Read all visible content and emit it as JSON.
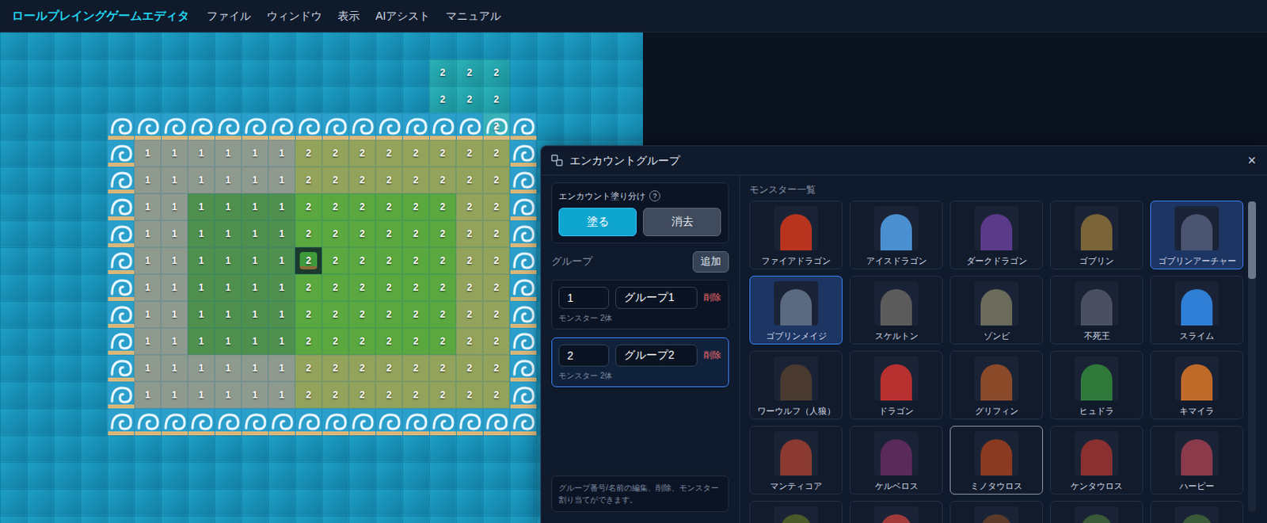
{
  "app": {
    "title": "ロールプレイングゲームエディタ",
    "menu": [
      "ファイル",
      "ウィンドウ",
      "表示",
      "AIアシスト",
      "マニュアル"
    ]
  },
  "map": {
    "rows": [
      {
        "terrain": "WWWWWWWWWWWWWWWWWWWWWWWW",
        "labels": "........................"
      },
      {
        "terrain": "WWWWWWWWWWWWWWWWwwwWWWWW",
        "labels": "................222....."
      },
      {
        "terrain": "WWWWWWWWWWWWWWWWwwwWWWWW",
        "labels": "................222....."
      },
      {
        "terrain": "WWWWSSSSSSSSSSSSSSsSWWWW",
        "labels": "..................2....."
      },
      {
        "terrain": "WWWWSAAAAAAEEEEEEEESWWWW",
        "labels": ".....11111122222222....."
      },
      {
        "terrain": "WWWWSAAAAAAEEEEEEEESWWWW",
        "labels": ".....11111122222222....."
      },
      {
        "terrain": "WWWWSAABBBBCCCCCCEESWWWW",
        "labels": ".....11111122222222....."
      },
      {
        "terrain": "WWWWSAABBBBCCCCCCEESWWWW",
        "labels": ".....11111122222222....."
      },
      {
        "terrain": "WWWWSAABBBBTCCCCCEESWWWW",
        "labels": ".....11111122222222....."
      },
      {
        "terrain": "WWWWSAABBBBCCCCCCEESWWWW",
        "labels": ".....11111122222222....."
      },
      {
        "terrain": "WWWWSAABBBBCCCCCCEESWWWW",
        "labels": ".....11111122222222....."
      },
      {
        "terrain": "WWWWSAABBBBCCCCCCEESWWWW",
        "labels": ".....11111122222222....."
      },
      {
        "terrain": "WWWWSAAAAAAEEEEEEEESWWWW",
        "labels": ".....11111122222222....."
      },
      {
        "terrain": "WWWWSAAAAAAEEEEEEEESWWWW",
        "labels": ".....11111122222222....."
      },
      {
        "terrain": "WWWWSSSSSSSSSSSSSSSSWWWW",
        "labels": "........................"
      },
      {
        "terrain": "WWWWWWWWWWWWWWWWWWWWWWWW",
        "labels": "........................"
      },
      {
        "terrain": "WWWWWWWWWWWWWWWWWWWWWWWW",
        "labels": "........................"
      },
      {
        "terrain": "WWWWWWWWWWWWWWWWWWWWWWWW",
        "labels": "........................"
      },
      {
        "terrain": "WWWWWWWWWWWWWWWWWWWWWWWW",
        "labels": "........................"
      }
    ]
  },
  "dialog": {
    "title": "エンカウントグループ",
    "close": "×",
    "paint": {
      "label": "エンカウント塗り分け",
      "help": "?",
      "modes": [
        {
          "label": "塗る",
          "selected": true
        },
        {
          "label": "消去",
          "selected": false
        }
      ]
    },
    "groups_label": "グループ",
    "add": "追加",
    "groups": [
      {
        "number": "1",
        "name": "グループ1",
        "delete": "削除",
        "count": "モンスター 2体",
        "selected": false
      },
      {
        "number": "2",
        "name": "グループ2",
        "delete": "削除",
        "count": "モンスター 2体",
        "selected": true
      }
    ],
    "hint": "グループ番号/名前の編集、削除、モンスター割り当てができます。",
    "monsters_label": "モンスター一覧",
    "monsters": [
      {
        "name": "ファイアドラゴン",
        "selected": false,
        "hovered": false,
        "color": "#b8341f"
      },
      {
        "name": "アイスドラゴン",
        "selected": false,
        "hovered": false,
        "color": "#4a8fd0"
      },
      {
        "name": "ダークドラゴン",
        "selected": false,
        "hovered": false,
        "color": "#5b3a8a"
      },
      {
        "name": "ゴブリン",
        "selected": false,
        "hovered": false,
        "color": "#7a6438"
      },
      {
        "name": "ゴブリンアーチャー",
        "selected": true,
        "hovered": false,
        "color": "#4a5470"
      },
      {
        "name": "ゴブリンメイジ",
        "selected": true,
        "hovered": false,
        "color": "#5a6a80"
      },
      {
        "name": "スケルトン",
        "selected": false,
        "hovered": false,
        "color": "#5b5b5b"
      },
      {
        "name": "ゾンビ",
        "selected": false,
        "hovered": false,
        "color": "#6b6b5b"
      },
      {
        "name": "不死王",
        "selected": false,
        "hovered": false,
        "color": "#4b5060"
      },
      {
        "name": "スライム",
        "selected": false,
        "hovered": false,
        "color": "#2f7fd6"
      },
      {
        "name": "ワーウルフ（人狼）",
        "selected": false,
        "hovered": false,
        "color": "#4a3a30"
      },
      {
        "name": "ドラゴン",
        "selected": false,
        "hovered": false,
        "color": "#b83030"
      },
      {
        "name": "グリフィン",
        "selected": false,
        "hovered": false,
        "color": "#8a4a2a"
      },
      {
        "name": "ヒュドラ",
        "selected": false,
        "hovered": false,
        "color": "#2f7a3a"
      },
      {
        "name": "キマイラ",
        "selected": false,
        "hovered": false,
        "color": "#c06a2a"
      },
      {
        "name": "マンティコア",
        "selected": false,
        "hovered": false,
        "color": "#8a3a30"
      },
      {
        "name": "ケルベロス",
        "selected": false,
        "hovered": false,
        "color": "#5a2a5a"
      },
      {
        "name": "ミノタウロス",
        "selected": false,
        "hovered": true,
        "color": "#8a3a20"
      },
      {
        "name": "ケンタウロス",
        "selected": false,
        "hovered": false,
        "color": "#8a3030"
      },
      {
        "name": "ハーピー",
        "selected": false,
        "hovered": false,
        "color": "#8a3a4a"
      },
      {
        "name": "",
        "selected": false,
        "hovered": false,
        "color": "#4a5a2a"
      },
      {
        "name": "",
        "selected": false,
        "hovered": false,
        "color": "#a03a3a"
      },
      {
        "name": "",
        "selected": false,
        "hovered": false,
        "color": "#5a3a2a"
      },
      {
        "name": "",
        "selected": false,
        "hovered": false,
        "color": "#3a5a3a"
      },
      {
        "name": "",
        "selected": false,
        "hovered": false,
        "color": "#3a5a3a"
      }
    ],
    "scroll": {
      "position": 0,
      "visible_share": 0.25
    }
  }
}
